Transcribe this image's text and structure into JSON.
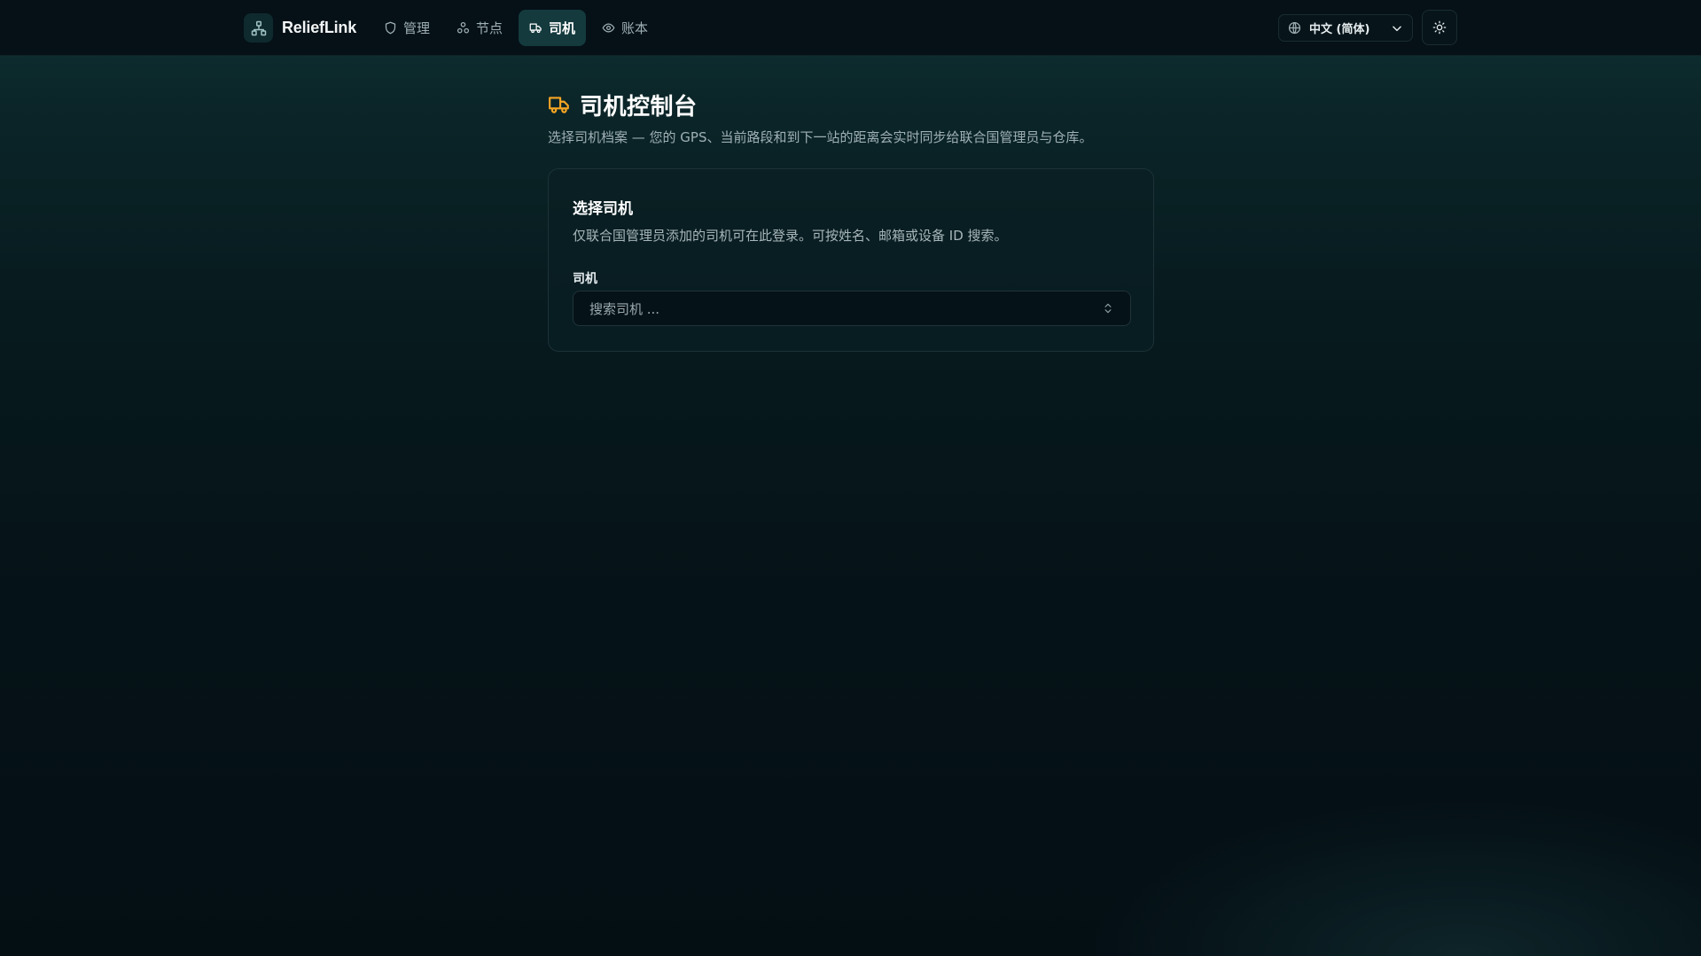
{
  "app": {
    "name": "ReliefLink"
  },
  "nav": {
    "items": [
      {
        "label": "管理",
        "icon": "shield-icon"
      },
      {
        "label": "节点",
        "icon": "nodes-icon"
      },
      {
        "label": "司机",
        "icon": "truck-icon",
        "active": true
      },
      {
        "label": "账本",
        "icon": "eye-icon"
      }
    ]
  },
  "header": {
    "language": "中文 (简体)",
    "language_icon": "globe-icon",
    "theme_icon": "sun-icon"
  },
  "page": {
    "title": "司机控制台",
    "subtitle": "选择司机档案 — 您的 GPS、当前路段和到下一站的距离会实时同步给联合国管理员与仓库。"
  },
  "card": {
    "title": "选择司机",
    "description": "仅联合国管理员添加的司机可在此登录。可按姓名、邮箱或设备 ID 搜索。",
    "field_label": "司机",
    "placeholder": "搜索司机 ..."
  },
  "colors": {
    "accent": "#f5a524",
    "active_nav": "#143a3e"
  }
}
